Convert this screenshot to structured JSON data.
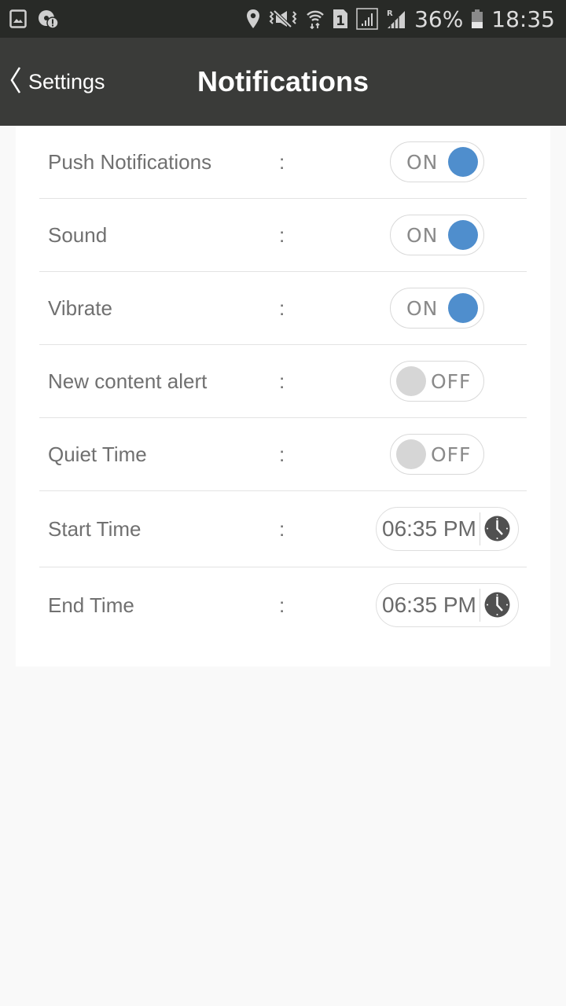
{
  "status_bar": {
    "left_icons": [
      "gallery-icon",
      "data-saver-alert-icon"
    ],
    "right_icons": [
      "location-icon",
      "vibrate-mute-icon",
      "wifi-icon",
      "sim-1-icon",
      "signal-icon",
      "roaming-signal-icon",
      "battery-icon"
    ],
    "roaming_indicator": "R",
    "sim_label": "1",
    "battery_percent": "36%",
    "battery_level": 0.36,
    "time": "18:35"
  },
  "app_bar": {
    "back_label": "Settings",
    "back_icon": "chevron-left-icon",
    "title": "Notifications"
  },
  "colors": {
    "status_bar_bg": "#282a27",
    "app_bar_bg": "#3a3b39",
    "toggle_on": "#4f8ecd",
    "toggle_off": "#d6d6d6",
    "label_text": "#707070",
    "page_bg": "#f9f9f9"
  },
  "settings": [
    {
      "label": "Push Notifications",
      "separator": ":",
      "type": "toggle",
      "state": "ON",
      "on": true
    },
    {
      "label": "Sound",
      "separator": ":",
      "type": "toggle",
      "state": "ON",
      "on": true
    },
    {
      "label": "Vibrate",
      "separator": ":",
      "type": "toggle",
      "state": "ON",
      "on": true
    },
    {
      "label": "New content alert",
      "separator": ":",
      "type": "toggle",
      "state": "OFF",
      "on": false
    },
    {
      "label": "Quiet Time",
      "separator": ":",
      "type": "toggle",
      "state": "OFF",
      "on": false
    },
    {
      "label": "Start Time",
      "separator": ":",
      "type": "time",
      "value": "06:35 PM",
      "icon": "clock-icon"
    },
    {
      "label": "End Time",
      "separator": ":",
      "type": "time",
      "value": "06:35 PM",
      "icon": "clock-icon"
    }
  ]
}
